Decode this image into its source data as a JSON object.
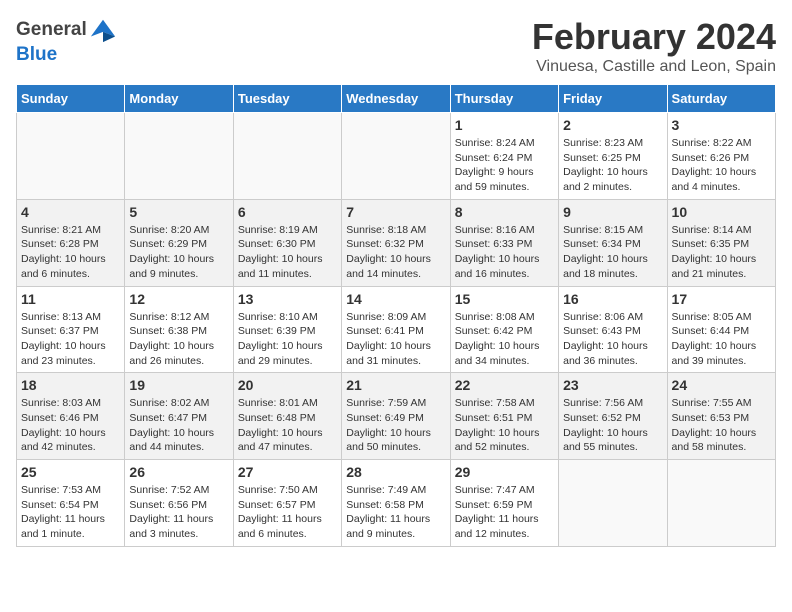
{
  "logo": {
    "general": "General",
    "blue": "Blue"
  },
  "header": {
    "title": "February 2024",
    "subtitle": "Vinuesa, Castille and Leon, Spain"
  },
  "weekdays": [
    "Sunday",
    "Monday",
    "Tuesday",
    "Wednesday",
    "Thursday",
    "Friday",
    "Saturday"
  ],
  "weeks": [
    {
      "shade": "white",
      "days": [
        {
          "num": "",
          "info": ""
        },
        {
          "num": "",
          "info": ""
        },
        {
          "num": "",
          "info": ""
        },
        {
          "num": "",
          "info": ""
        },
        {
          "num": "1",
          "info": "Sunrise: 8:24 AM\nSunset: 6:24 PM\nDaylight: 9 hours\nand 59 minutes."
        },
        {
          "num": "2",
          "info": "Sunrise: 8:23 AM\nSunset: 6:25 PM\nDaylight: 10 hours\nand 2 minutes."
        },
        {
          "num": "3",
          "info": "Sunrise: 8:22 AM\nSunset: 6:26 PM\nDaylight: 10 hours\nand 4 minutes."
        }
      ]
    },
    {
      "shade": "shaded",
      "days": [
        {
          "num": "4",
          "info": "Sunrise: 8:21 AM\nSunset: 6:28 PM\nDaylight: 10 hours\nand 6 minutes."
        },
        {
          "num": "5",
          "info": "Sunrise: 8:20 AM\nSunset: 6:29 PM\nDaylight: 10 hours\nand 9 minutes."
        },
        {
          "num": "6",
          "info": "Sunrise: 8:19 AM\nSunset: 6:30 PM\nDaylight: 10 hours\nand 11 minutes."
        },
        {
          "num": "7",
          "info": "Sunrise: 8:18 AM\nSunset: 6:32 PM\nDaylight: 10 hours\nand 14 minutes."
        },
        {
          "num": "8",
          "info": "Sunrise: 8:16 AM\nSunset: 6:33 PM\nDaylight: 10 hours\nand 16 minutes."
        },
        {
          "num": "9",
          "info": "Sunrise: 8:15 AM\nSunset: 6:34 PM\nDaylight: 10 hours\nand 18 minutes."
        },
        {
          "num": "10",
          "info": "Sunrise: 8:14 AM\nSunset: 6:35 PM\nDaylight: 10 hours\nand 21 minutes."
        }
      ]
    },
    {
      "shade": "white",
      "days": [
        {
          "num": "11",
          "info": "Sunrise: 8:13 AM\nSunset: 6:37 PM\nDaylight: 10 hours\nand 23 minutes."
        },
        {
          "num": "12",
          "info": "Sunrise: 8:12 AM\nSunset: 6:38 PM\nDaylight: 10 hours\nand 26 minutes."
        },
        {
          "num": "13",
          "info": "Sunrise: 8:10 AM\nSunset: 6:39 PM\nDaylight: 10 hours\nand 29 minutes."
        },
        {
          "num": "14",
          "info": "Sunrise: 8:09 AM\nSunset: 6:41 PM\nDaylight: 10 hours\nand 31 minutes."
        },
        {
          "num": "15",
          "info": "Sunrise: 8:08 AM\nSunset: 6:42 PM\nDaylight: 10 hours\nand 34 minutes."
        },
        {
          "num": "16",
          "info": "Sunrise: 8:06 AM\nSunset: 6:43 PM\nDaylight: 10 hours\nand 36 minutes."
        },
        {
          "num": "17",
          "info": "Sunrise: 8:05 AM\nSunset: 6:44 PM\nDaylight: 10 hours\nand 39 minutes."
        }
      ]
    },
    {
      "shade": "shaded",
      "days": [
        {
          "num": "18",
          "info": "Sunrise: 8:03 AM\nSunset: 6:46 PM\nDaylight: 10 hours\nand 42 minutes."
        },
        {
          "num": "19",
          "info": "Sunrise: 8:02 AM\nSunset: 6:47 PM\nDaylight: 10 hours\nand 44 minutes."
        },
        {
          "num": "20",
          "info": "Sunrise: 8:01 AM\nSunset: 6:48 PM\nDaylight: 10 hours\nand 47 minutes."
        },
        {
          "num": "21",
          "info": "Sunrise: 7:59 AM\nSunset: 6:49 PM\nDaylight: 10 hours\nand 50 minutes."
        },
        {
          "num": "22",
          "info": "Sunrise: 7:58 AM\nSunset: 6:51 PM\nDaylight: 10 hours\nand 52 minutes."
        },
        {
          "num": "23",
          "info": "Sunrise: 7:56 AM\nSunset: 6:52 PM\nDaylight: 10 hours\nand 55 minutes."
        },
        {
          "num": "24",
          "info": "Sunrise: 7:55 AM\nSunset: 6:53 PM\nDaylight: 10 hours\nand 58 minutes."
        }
      ]
    },
    {
      "shade": "white",
      "days": [
        {
          "num": "25",
          "info": "Sunrise: 7:53 AM\nSunset: 6:54 PM\nDaylight: 11 hours\nand 1 minute."
        },
        {
          "num": "26",
          "info": "Sunrise: 7:52 AM\nSunset: 6:56 PM\nDaylight: 11 hours\nand 3 minutes."
        },
        {
          "num": "27",
          "info": "Sunrise: 7:50 AM\nSunset: 6:57 PM\nDaylight: 11 hours\nand 6 minutes."
        },
        {
          "num": "28",
          "info": "Sunrise: 7:49 AM\nSunset: 6:58 PM\nDaylight: 11 hours\nand 9 minutes."
        },
        {
          "num": "29",
          "info": "Sunrise: 7:47 AM\nSunset: 6:59 PM\nDaylight: 11 hours\nand 12 minutes."
        },
        {
          "num": "",
          "info": ""
        },
        {
          "num": "",
          "info": ""
        }
      ]
    }
  ]
}
